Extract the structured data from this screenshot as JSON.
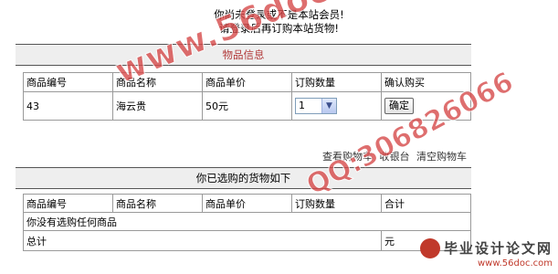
{
  "notice": {
    "line1": "你尚未登录或不是本站会员!",
    "line2": "请登录后再订购本站货物!"
  },
  "product_section": {
    "title": "物品信息",
    "headers": [
      "商品编号",
      "商品名称",
      "商品单价",
      "订购数量",
      "确认购买"
    ],
    "row": {
      "id": "43",
      "name": "海云贵",
      "price": "50元",
      "quantity": "1",
      "confirm_label": "确定"
    }
  },
  "cart_links": {
    "view_cart": "查看购物车",
    "checkout": "收银台",
    "clear_cart": "清空购物车"
  },
  "cart_section": {
    "title": "你已选购的货物如下",
    "headers": [
      "商品编号",
      "商品名称",
      "商品单价",
      "订购数量",
      "合计"
    ],
    "empty_message": "你没有选购任何商品",
    "total_label": "总计",
    "total_value": "元"
  },
  "watermark": {
    "site": "www.56doc.com",
    "qq": "QQ:306826066",
    "brand": "毕业设计论文网",
    "brand_url": "www.56doc.com"
  },
  "colors": {
    "section_title": "#b23a3a",
    "section_bg": "#eeeeee",
    "watermark": "#d64a4a"
  }
}
